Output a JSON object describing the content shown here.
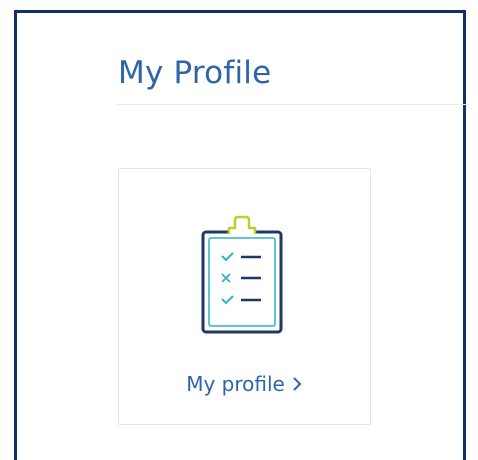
{
  "page": {
    "title": "My Profile"
  },
  "profile_card": {
    "label": "My profile",
    "icon": "clipboard-checklist-icon",
    "chevron": "chevron-right-icon"
  },
  "colors": {
    "frame": "#13305e",
    "title_text": "#2f65a8",
    "icon_dark": "#1e3766",
    "icon_accent_teal": "#2cb4c8",
    "icon_accent_lime": "#b9cf2a"
  }
}
